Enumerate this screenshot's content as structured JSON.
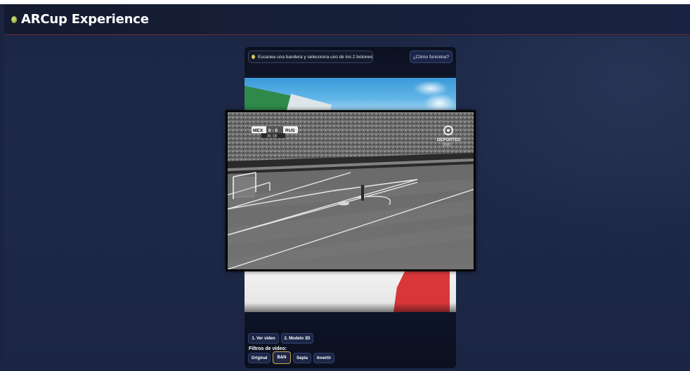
{
  "app": {
    "title": "ARCup Experience"
  },
  "phone": {
    "hint": "Escanea una bandera y selecciona uno de los 2 botones",
    "how_button": "¿Cómo funciona?",
    "actions": [
      "1. Ver video",
      "2. Modelo 3D"
    ],
    "filters_label": "Filtros de video:",
    "filters": [
      "Original",
      "B&N",
      "Sepia",
      "Invertir"
    ],
    "active_filter": "B&N"
  },
  "video": {
    "score_home": "MEX",
    "score": "0 - 0",
    "score_away": "RUS",
    "clock": "31:18",
    "broadcaster": "DEPORTES",
    "broadcaster_sub": "VIVO",
    "filter_applied": "B&N"
  },
  "colors": {
    "page_bg": "#1a2440",
    "header_bg": "#141b30",
    "button_bg": "#1b2647",
    "active_border": "#c9a24a"
  },
  "icons": {
    "logo": "green-dot-icon",
    "hint": "lightbulb-icon"
  }
}
